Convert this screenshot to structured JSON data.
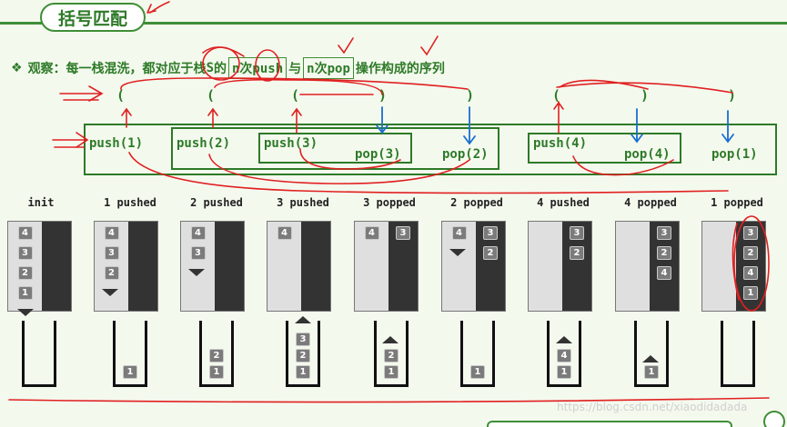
{
  "title": "括号匹配",
  "headline": {
    "bullet": "❖",
    "text1": "观察：每一栈混洗，都对应于栈",
    "stack_var": "S",
    "text2": "的",
    "push_box": "n次push",
    "text3": "与",
    "pop_box": "n次pop",
    "text4": "操作构成的序列"
  },
  "parens": [
    "(",
    "(",
    "(",
    ")",
    ")",
    "(",
    ")",
    ")"
  ],
  "ops": [
    "push(1)",
    "push(2)",
    "push(3)",
    "pop(3)",
    "pop(2)",
    "push(4)",
    "pop(4)",
    "pop(1)"
  ],
  "steps": [
    {
      "label": "init",
      "left": [
        "4",
        "3",
        "2",
        "1"
      ],
      "right": [],
      "cup": []
    },
    {
      "label": "1 pushed",
      "left": [
        "4",
        "3",
        "2"
      ],
      "right": [],
      "cup": [
        "1"
      ]
    },
    {
      "label": "2 pushed",
      "left": [
        "4",
        "3"
      ],
      "right": [],
      "cup": [
        "1",
        "2"
      ]
    },
    {
      "label": "3 pushed",
      "left": [
        "4"
      ],
      "right": [],
      "cup": [
        "1",
        "2",
        "3"
      ]
    },
    {
      "label": "3 popped",
      "left": [
        "4"
      ],
      "right": [
        "3"
      ],
      "cup": [
        "1",
        "2"
      ]
    },
    {
      "label": "2 popped",
      "left": [
        "4"
      ],
      "right": [
        "3",
        "2"
      ],
      "cup": [
        "1"
      ]
    },
    {
      "label": "4 pushed",
      "left": [],
      "right": [
        "3",
        "2"
      ],
      "cup": [
        "1",
        "4"
      ]
    },
    {
      "label": "4 popped",
      "left": [],
      "right": [
        "3",
        "2",
        "4"
      ],
      "cup": [
        "1"
      ]
    },
    {
      "label": "1 popped",
      "left": [],
      "right": [
        "3",
        "2",
        "4",
        "1"
      ],
      "cup": []
    }
  ],
  "watermark": "https://blog.csdn.net/xiaodidadada",
  "colors": {
    "green": "#2d7a27",
    "annotation_red": "#e02020",
    "annotation_blue": "#1a6fd0",
    "panel_dark": "#333333",
    "panel_light": "#dfdfdf",
    "tile": "#7b7b7b"
  }
}
